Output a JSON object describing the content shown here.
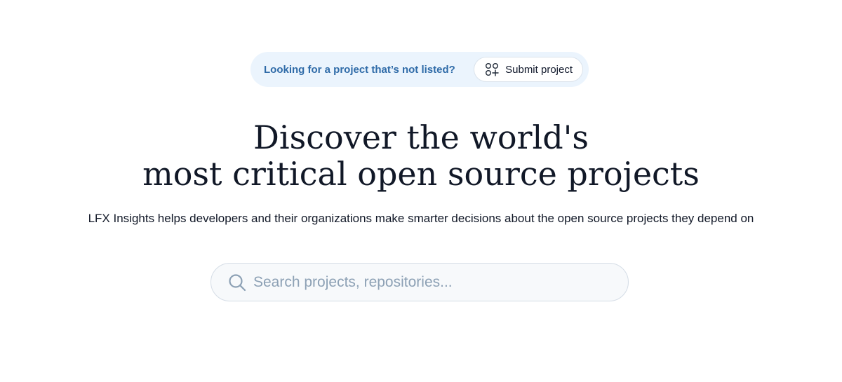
{
  "banner": {
    "text": "Looking for a project that’s not listed?",
    "button_label": "Submit project",
    "button_icon": "shapes-plus-icon"
  },
  "hero": {
    "title_line1": "Discover the world's",
    "title_line2": "most critical open source projects",
    "subtitle": "LFX Insights helps developers and their organizations make smarter decisions about the open source projects they depend on"
  },
  "search": {
    "placeholder": "Search projects, repositories...",
    "value": "",
    "icon": "search-icon"
  },
  "colors": {
    "banner_bg": "#ebf4fd",
    "banner_text": "#2f6ba8",
    "heading": "#111827",
    "search_bg": "#f7f9fb",
    "search_border": "#d5dde6",
    "placeholder": "#8da1b5"
  }
}
